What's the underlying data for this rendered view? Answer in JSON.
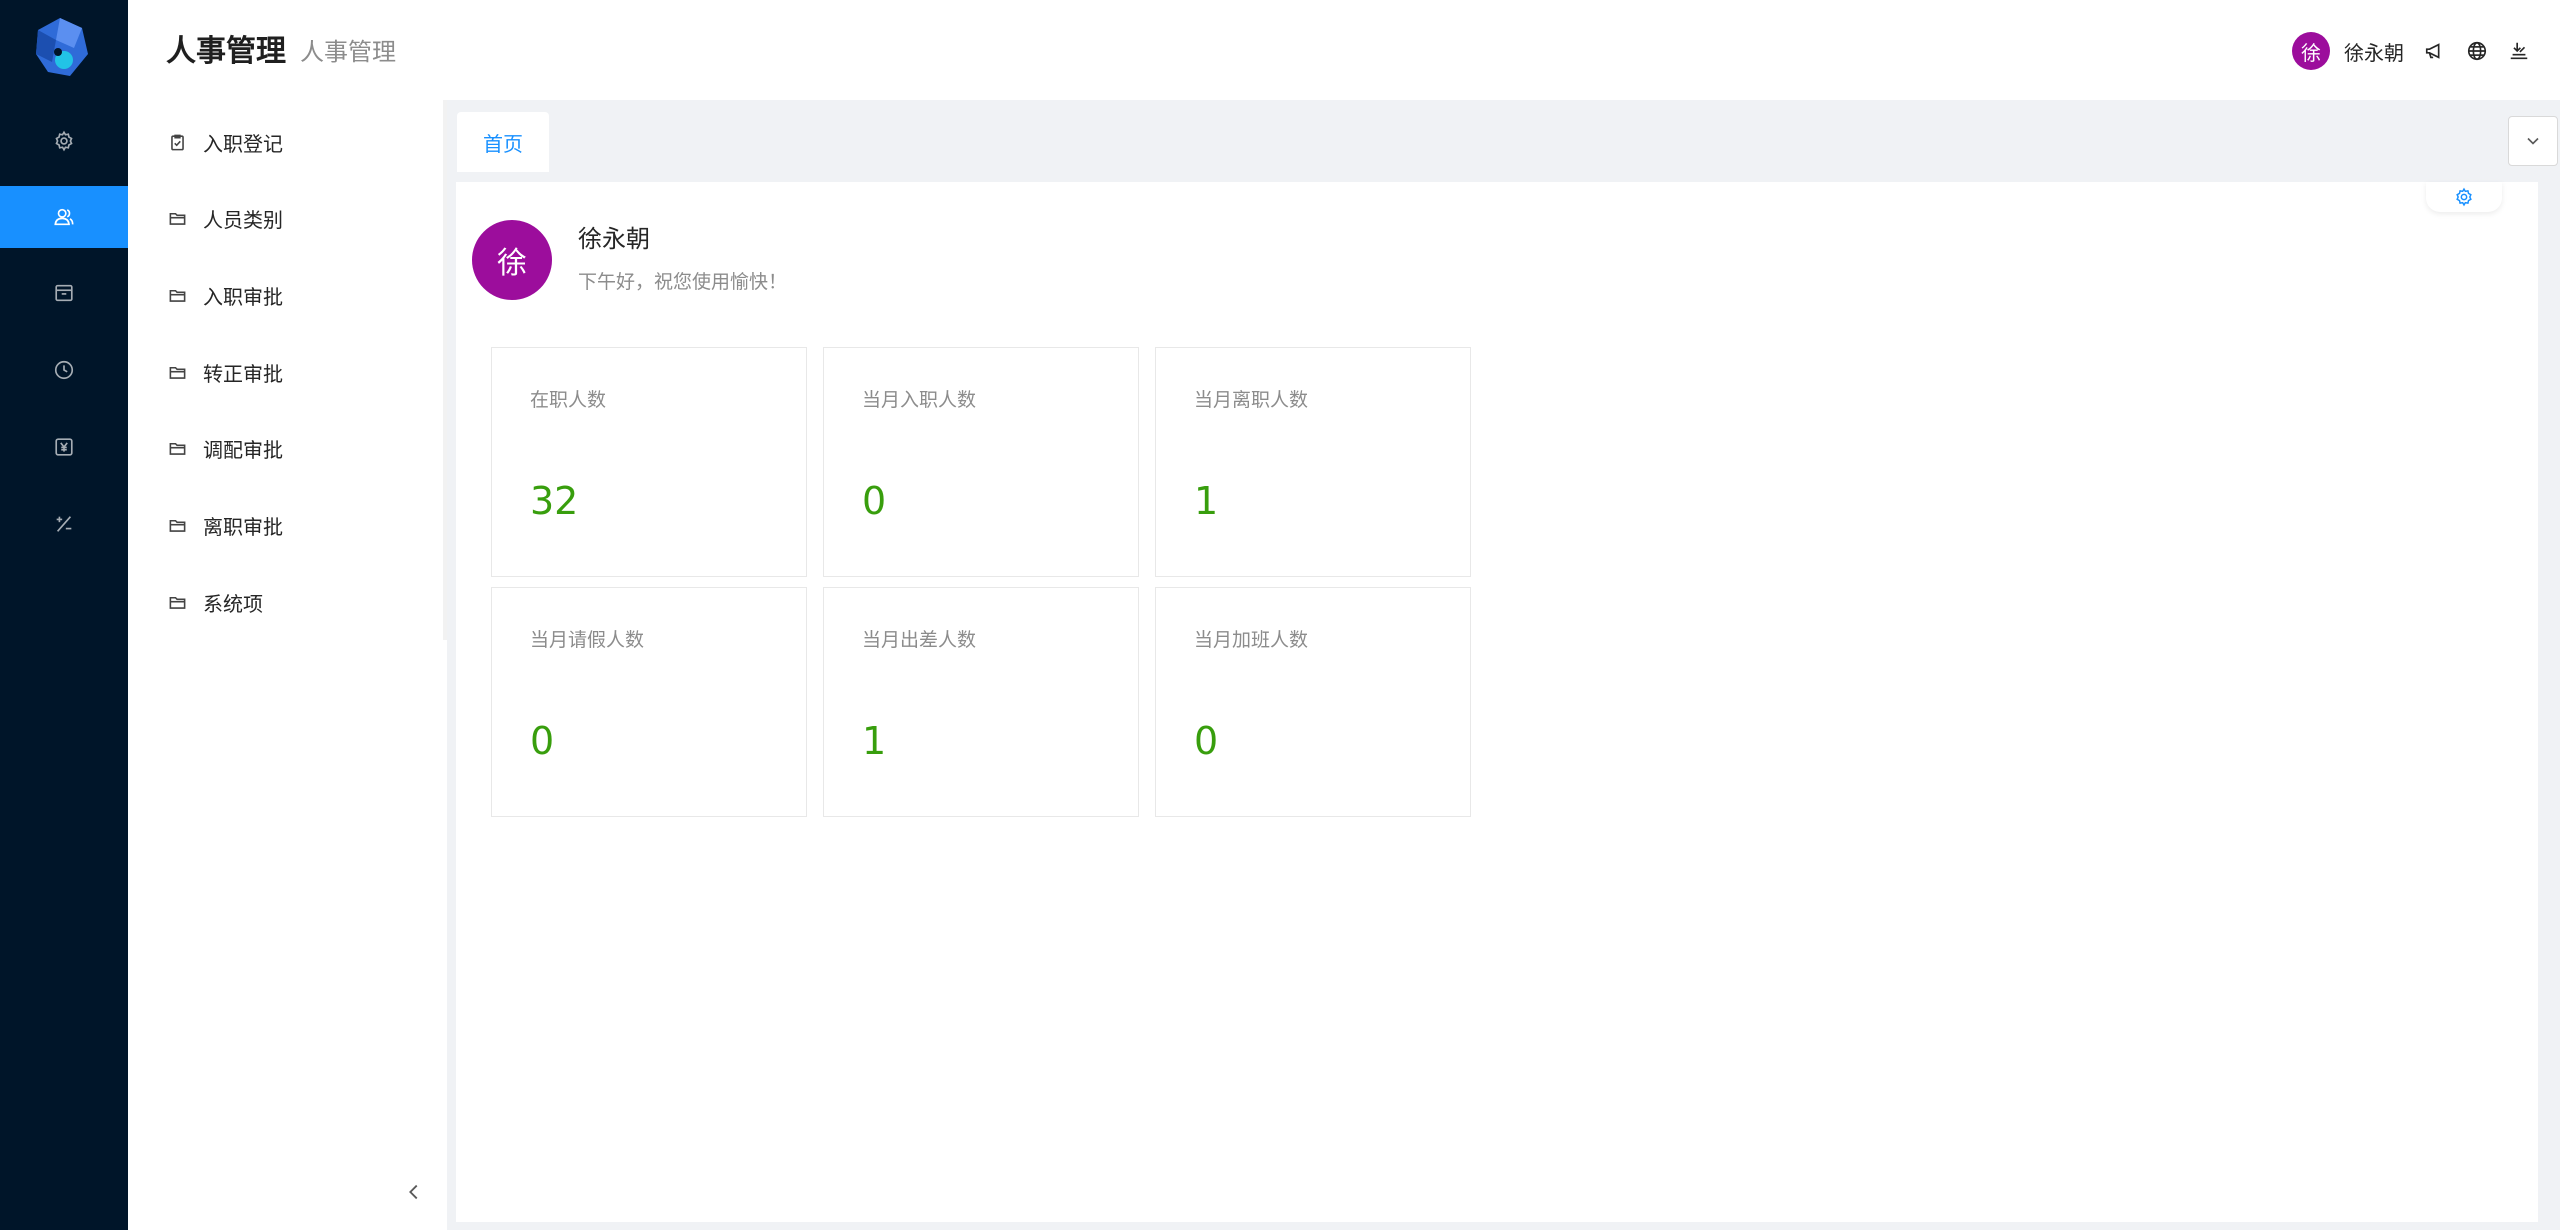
{
  "header": {
    "title": "人事管理",
    "subtitle": "人事管理",
    "user": {
      "avatar_text": "徐",
      "name": "徐永朝"
    },
    "icons": [
      "notification-icon",
      "globe-icon",
      "download-icon"
    ]
  },
  "rail": {
    "items": [
      {
        "icon": "settings-icon",
        "active": false
      },
      {
        "icon": "users-icon",
        "active": true
      },
      {
        "icon": "box-icon",
        "active": false
      },
      {
        "icon": "clock-icon",
        "active": false
      },
      {
        "icon": "yen-icon",
        "active": false
      },
      {
        "icon": "plus-minus-icon",
        "active": false
      }
    ]
  },
  "submenu": {
    "items": [
      {
        "label": "入职登记",
        "icon": "clipboard-icon"
      },
      {
        "label": "人员类别",
        "icon": "folder-icon"
      },
      {
        "label": "入职审批",
        "icon": "folder-icon"
      },
      {
        "label": "转正审批",
        "icon": "folder-icon"
      },
      {
        "label": "调配审批",
        "icon": "folder-icon"
      },
      {
        "label": "离职审批",
        "icon": "folder-icon"
      },
      {
        "label": "系统项",
        "icon": "folder-icon"
      }
    ]
  },
  "tabs": [
    {
      "label": "首页",
      "active": true
    }
  ],
  "welcome": {
    "avatar_text": "徐",
    "name": "徐永朝",
    "message": "下午好，祝您使用愉快！"
  },
  "stats": [
    {
      "label": "在职人数",
      "value": "32"
    },
    {
      "label": "当月入职人数",
      "value": "0"
    },
    {
      "label": "当月离职人数",
      "value": "1"
    },
    {
      "label": "当月请假人数",
      "value": "0"
    },
    {
      "label": "当月出差人数",
      "value": "1"
    },
    {
      "label": "当月加班人数",
      "value": "0"
    }
  ],
  "colors": {
    "rail_bg": "#001529",
    "accent": "#1890ff",
    "avatar_bg": "#9c0d9c",
    "stat_value": "#389e0d"
  }
}
